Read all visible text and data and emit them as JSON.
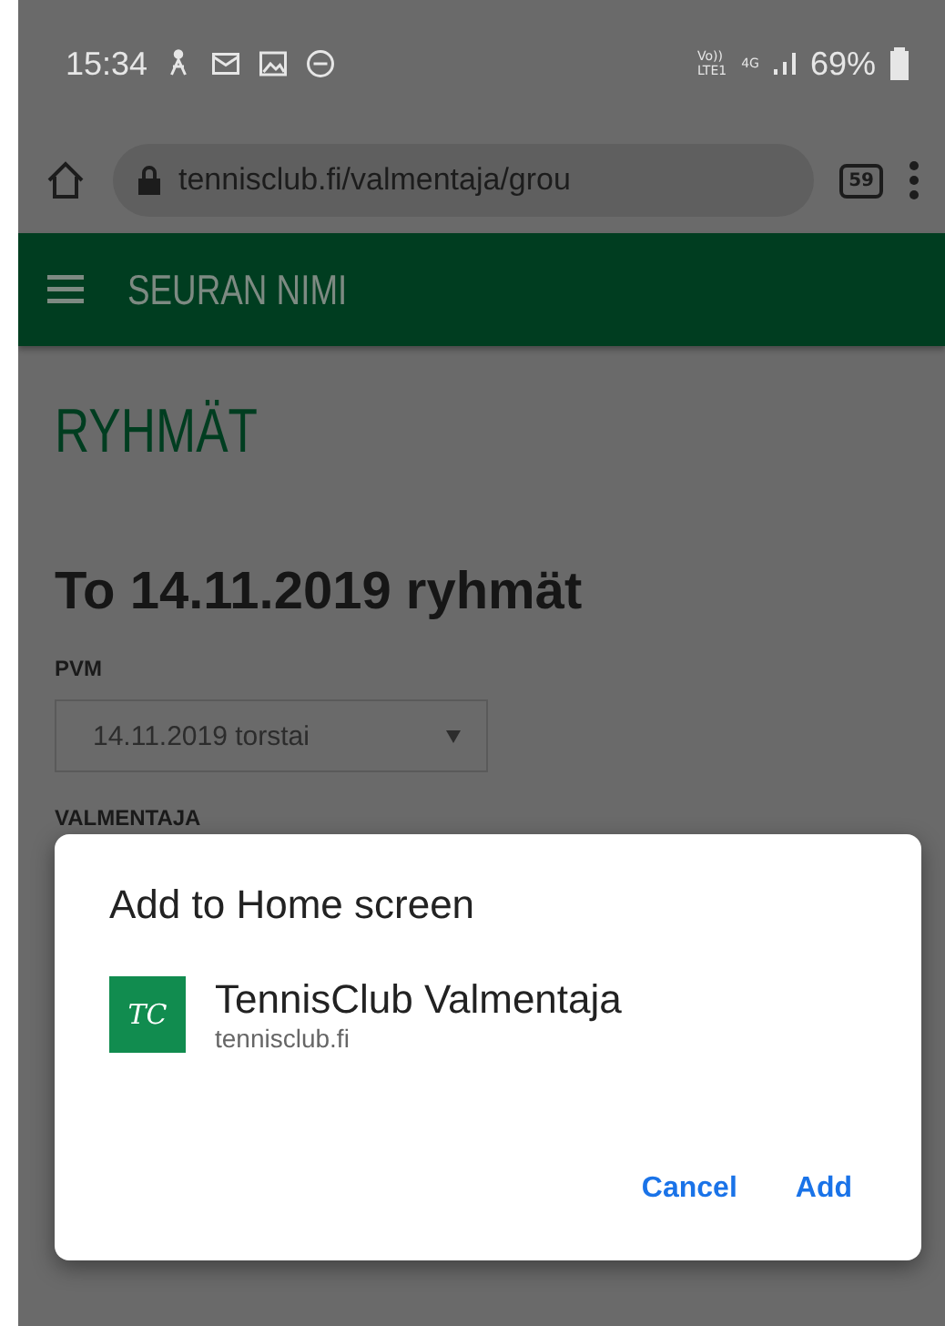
{
  "status_bar": {
    "time": "15:34",
    "network_top": "Vo))",
    "network_bottom": "LTE1",
    "network_type": "4G",
    "battery": "69%"
  },
  "browser": {
    "url": "tennisclub.fi/valmentaja/grou",
    "tab_count": "59"
  },
  "app_bar": {
    "title": "SEURAN NIMI"
  },
  "page": {
    "heading": "RYHMÄT",
    "subheading": "To 14.11.2019 ryhmät",
    "date_label": "PVM",
    "date_value": "14.11.2019 torstai",
    "coach_label": "VALMENTAJA"
  },
  "dialog": {
    "title": "Add to Home screen",
    "app_icon_text": "TC",
    "app_name": "TennisClub Valmentaja",
    "app_domain": "tennisclub.fi",
    "buttons": [
      {
        "label": "Cancel",
        "kind": "text"
      },
      {
        "label": "Add",
        "kind": "text"
      }
    ]
  }
}
